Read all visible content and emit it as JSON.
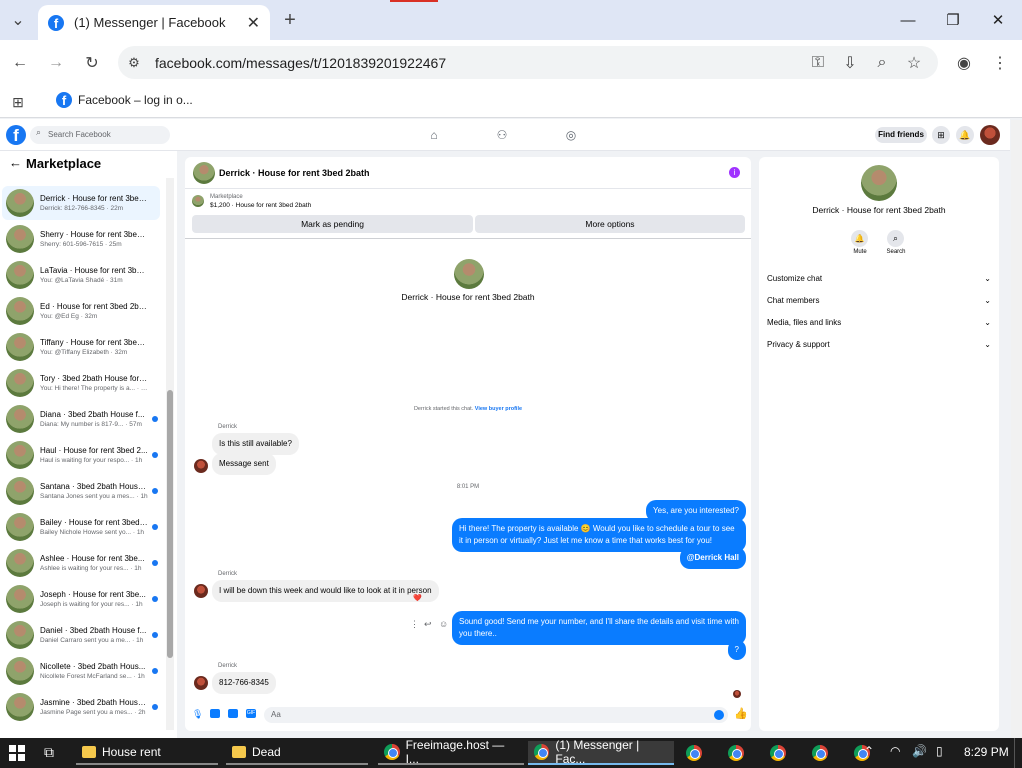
{
  "browser": {
    "tab_title": "(1) Messenger | Facebook",
    "url": "facebook.com/messages/t/1201839201922467",
    "bookmark": "Facebook – log in o..."
  },
  "fb": {
    "search_placeholder": "Search Facebook",
    "find_friends": "Find friends"
  },
  "sidebar": {
    "title": "Marketplace",
    "chats": [
      {
        "name": "Derrick · House for rent 3bed ...",
        "snippet": "Derrick: 812-766-8345 · 22m",
        "unread": false,
        "selected": true
      },
      {
        "name": "Sherry · House for rent 3bed 2...",
        "snippet": "Sherry: 601-596-7615 · 25m",
        "unread": false,
        "selected": false
      },
      {
        "name": "LaTavia · House for rent 3bed ...",
        "snippet": "You: @LaTavia Shadé · 31m",
        "unread": false,
        "selected": false
      },
      {
        "name": "Ed · House for rent 3bed 2bath",
        "snippet": "You: @Ed Eg · 32m",
        "unread": false,
        "selected": false
      },
      {
        "name": "Tiffany · House for rent 3bed ...",
        "snippet": "You: @Tiffany Elizabeth · 32m",
        "unread": false,
        "selected": false
      },
      {
        "name": "Tory · 3bed 2bath House for r...",
        "snippet": "You: Hi there! The property is a... · 32m",
        "unread": false,
        "selected": false
      },
      {
        "name": "Diana · 3bed 2bath House f...",
        "snippet": "Diana: My number is 817-9... · 57m",
        "unread": true,
        "selected": false
      },
      {
        "name": "Haul · House for rent 3bed 2...",
        "snippet": "Haul is waiting for your respo... · 1h",
        "unread": true,
        "selected": false
      },
      {
        "name": "Santana · 3bed 2bath House...",
        "snippet": "Santana Jones sent you a mes... · 1h",
        "unread": true,
        "selected": false
      },
      {
        "name": "Bailey · House for rent 3bed ...",
        "snippet": "Bailey Nichole Howse sent yo... · 1h",
        "unread": true,
        "selected": false
      },
      {
        "name": "Ashlee · House for rent 3be...",
        "snippet": "Ashlee is waiting for your res... · 1h",
        "unread": true,
        "selected": false
      },
      {
        "name": "Joseph · House for rent 3be...",
        "snippet": "Joseph is waiting for your res... · 1h",
        "unread": true,
        "selected": false
      },
      {
        "name": "Daniel · 3bed 2bath House f...",
        "snippet": "Daniel Carraro sent you a me... · 1h",
        "unread": true,
        "selected": false
      },
      {
        "name": "Nicollete · 3bed 2bath Hous...",
        "snippet": "Nicollete Forest McFarland se... · 1h",
        "unread": true,
        "selected": false
      },
      {
        "name": "Jasmine · 3bed 2bath House...",
        "snippet": "Jasmine Page sent you a mes... · 2h",
        "unread": true,
        "selected": false
      }
    ]
  },
  "conversation": {
    "header_title": "Derrick · House for rent 3bed 2bath",
    "listing_label": "Marketplace",
    "listing_detail": "$1,200 · House for rent 3bed 2bath",
    "mark_pending": "Mark as pending",
    "more_options": "More options",
    "profile_name": "Derrick · House for rent 3bed 2bath",
    "started_text": "Derrick started this chat.",
    "view_profile": "View buyer profile",
    "sender1": "Derrick",
    "msg_available": "Is this still available?",
    "msg_sent": "Message sent",
    "time_sep": "8:01 PM",
    "out1": "Yes, are you interested?",
    "out2": "Hi there! The property is available 😊 Would you like to schedule a tour to see it in person or virtually? Just let me know a time that works best for you!",
    "out3": "@Derrick Hall",
    "sender2": "Derrick",
    "in2": "I will be down this week and would like to look at it in person",
    "reaction": "❤️",
    "out4": "Sound good! Send me your number, and I'll share the details and visit time with you there..",
    "out5": "?",
    "sender3": "Derrick",
    "in3": "812-766-8345",
    "composer_placeholder": "Aa"
  },
  "details": {
    "name": "Derrick · House for rent 3bed 2bath",
    "mute": "Mute",
    "search": "Search",
    "sections": [
      "Customize chat",
      "Chat members",
      "Media, files and links",
      "Privacy & support"
    ]
  },
  "taskbar": {
    "items": [
      "House rent",
      "Dead",
      "Freeimage.host — I...",
      "(1) Messenger | Fac..."
    ],
    "time": "8:29 PM"
  }
}
